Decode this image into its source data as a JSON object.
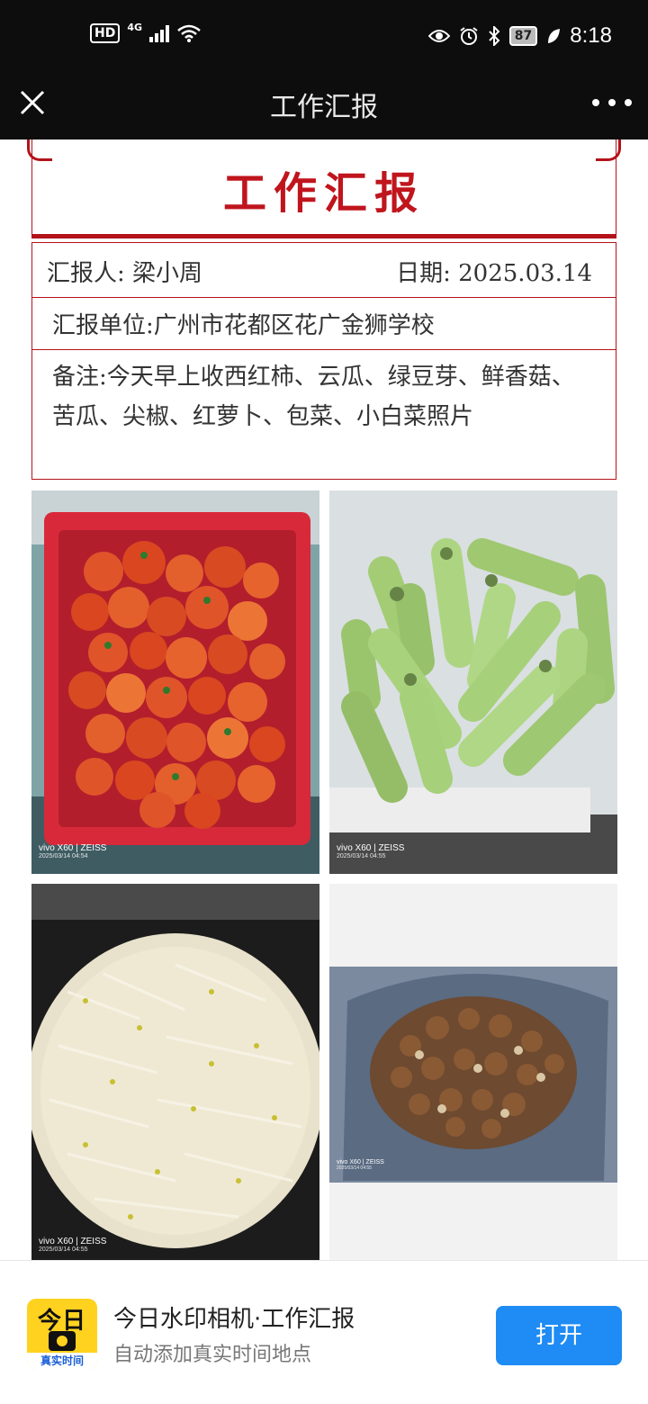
{
  "status_bar": {
    "hd_label": "HD",
    "network_label": "4G",
    "battery_level": "87",
    "time": "8:18"
  },
  "title_bar": {
    "title": "工作汇报"
  },
  "report": {
    "heading": "工作汇报",
    "reporter": "汇报人:  梁小周",
    "date": "日期:  2025.03.14",
    "unit": "汇报单位:广州市花都区花广金狮学校",
    "remarks": "备注:今天早上收西红柿、云瓜、绿豆芽、鲜香菇、苦瓜、尖椒、红萝卜、包菜、小白菜照片",
    "photos": [
      {
        "brand": "vivo X60 | ZEISS",
        "timestamp": "2025/03/14 04:54"
      },
      {
        "brand": "vivo X60 | ZEISS",
        "timestamp": "2025/03/14 04:55"
      },
      {
        "brand": "vivo X60 | ZEISS",
        "timestamp": "2025/03/14 04:55"
      },
      {
        "brand": "vivo X60 | ZEISS",
        "timestamp": "2025/03/14 04:55"
      }
    ]
  },
  "banner": {
    "app_icon_text": "今日",
    "app_icon_strip": "真实时间",
    "title": "今日水印相机·工作汇报",
    "subtitle": "自动添加真实时间地点",
    "open_button": "打开"
  },
  "colors": {
    "accent_red": "#b3121a",
    "open_button": "#1f8bf4",
    "app_icon": "#ffd21f"
  }
}
